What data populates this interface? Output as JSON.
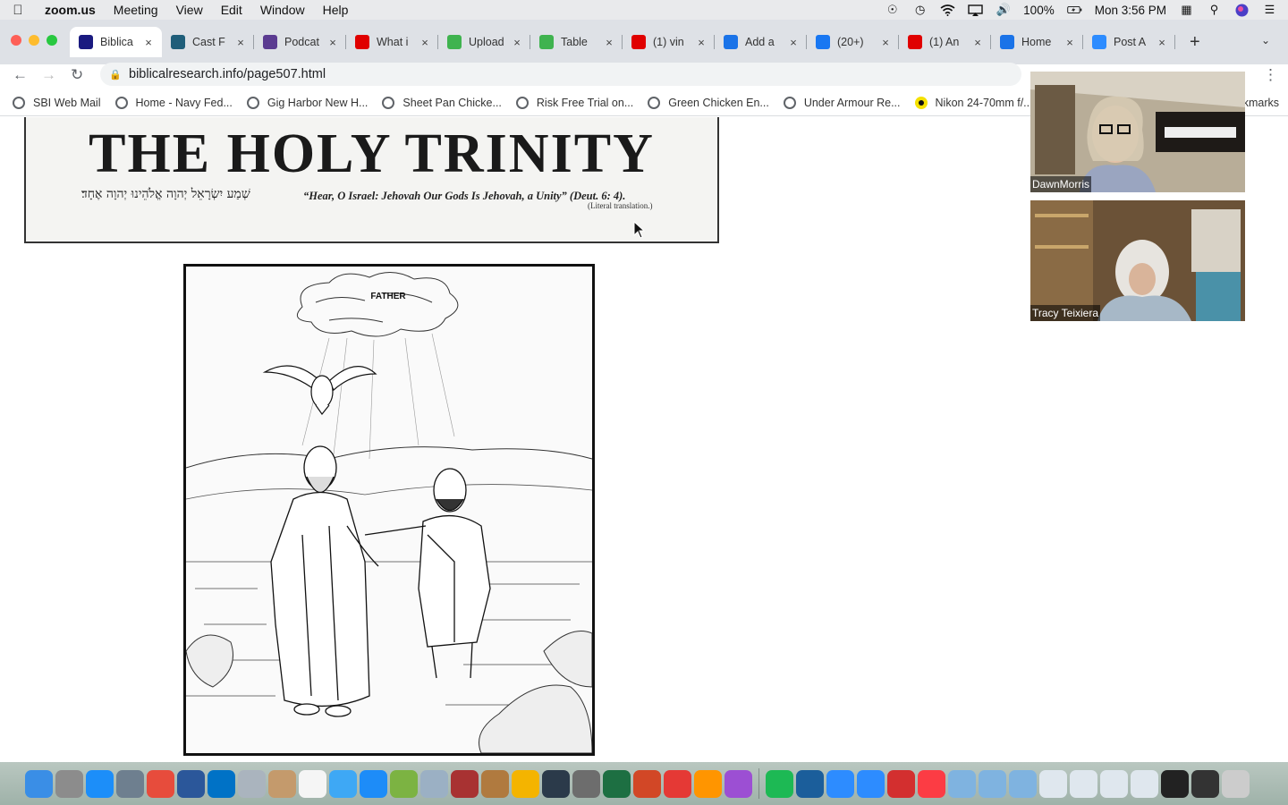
{
  "menubar": {
    "app_name": "zoom.us",
    "items": [
      "Meeting",
      "View",
      "Edit",
      "Window",
      "Help"
    ],
    "battery": "100%",
    "clock": "Mon 3:56 PM"
  },
  "tabs": [
    {
      "title": "Biblica",
      "color": "#1a1a80",
      "active": true
    },
    {
      "title": "Cast F",
      "color": "#1f5e7a"
    },
    {
      "title": "Podcat",
      "color": "#5b3b91"
    },
    {
      "title": "What i",
      "color": "#e00000"
    },
    {
      "title": "Upload",
      "color": "#3fb34f"
    },
    {
      "title": "Table",
      "color": "#3fb34f"
    },
    {
      "title": "(1) vin",
      "color": "#e00000"
    },
    {
      "title": "Add a",
      "color": "#1a73e8"
    },
    {
      "title": "(20+)",
      "color": "#1877f2"
    },
    {
      "title": "(1) An",
      "color": "#e00000"
    },
    {
      "title": "Home",
      "color": "#1a73e8"
    },
    {
      "title": "Post A",
      "color": "#2d8cff"
    }
  ],
  "address_bar": {
    "url": "biblicalresearch.info/page507.html"
  },
  "bookmarks": [
    {
      "label": "SBI Web Mail",
      "icon": "globe-icon"
    },
    {
      "label": "Home - Navy Fed...",
      "icon": "globe-icon"
    },
    {
      "label": "Gig Harbor New H...",
      "icon": "globe-icon"
    },
    {
      "label": "Sheet Pan Chicke...",
      "icon": "globe-icon"
    },
    {
      "label": "Risk Free Trial on...",
      "icon": "globe-icon"
    },
    {
      "label": "Green Chicken En...",
      "icon": "globe-icon"
    },
    {
      "label": "Under Armour Re...",
      "icon": "globe-icon"
    },
    {
      "label": "Nikon 24-70mm f/...",
      "icon": "nikon-icon"
    }
  ],
  "bookmarks_more": "kmarks",
  "page": {
    "heading": "THE HOLY TRINITY",
    "hebrew": "שְׁמַע יִשְׂרָאֵל יְהוָה אֱלֹהֵינוּ יְהוָה אֶחָד׃",
    "verse": "“Hear, O Israel: Jehovah Our Gods Is Jehovah, a Unity” (Deut. 6: 4).",
    "note": "(Literal translation.)",
    "illustration_label": "FATHER"
  },
  "participants": [
    {
      "name": "DawnMorris"
    },
    {
      "name": "Tracy Teixiera"
    }
  ]
}
